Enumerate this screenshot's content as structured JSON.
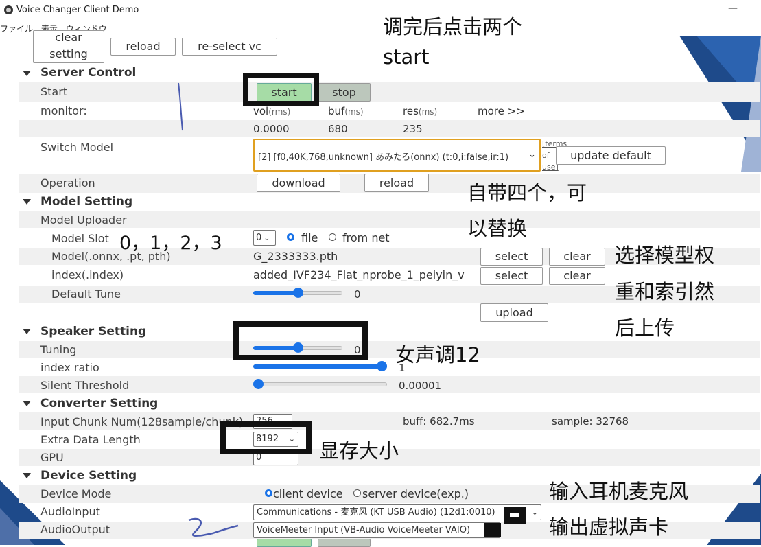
{
  "window": {
    "title": "Voice Changer Client Demo",
    "minimize": "—",
    "maximize": "☐",
    "close": "✕"
  },
  "menu": [
    "ファイル",
    "表示",
    "ウィンドウ"
  ],
  "top_buttons": {
    "clear_line1": "clear",
    "clear_line2": "setting",
    "reload": "reload",
    "reselect": "re-select vc"
  },
  "server_control": {
    "title": "Server Control",
    "start_label": "Start",
    "start_btn": "start",
    "stop_btn": "stop",
    "monitor_label": "monitor:",
    "vol": "vol",
    "vol_unit": "(rms)",
    "buf": "buf",
    "buf_unit": "(ms)",
    "res": "res",
    "res_unit": "(ms)",
    "more": "more >>",
    "vol_value": "0.0000",
    "buf_value": "680",
    "res_value": "235",
    "switch_model_label": "Switch Model",
    "model_selected": "[2] [f0,40K,768,unknown] あみたろ(onnx) (t:0,i:false,ir:1)",
    "terms": "[terms",
    "of": "of",
    "use": "use]",
    "update_default": "update default",
    "operation_label": "Operation",
    "download": "download",
    "reload": "reload"
  },
  "model_setting": {
    "title": "Model Setting",
    "uploader_label": "Model Uploader",
    "slot_label": "Model Slot",
    "slot_value": "0",
    "file_option": "file",
    "net_option": "from net",
    "model_label": "Model(.onnx, .pt, pth)",
    "model_file": "G_2333333.pth",
    "index_label": "index(.index)",
    "index_file": "added_IVF234_Flat_nprobe_1_peiyin_v",
    "select": "select",
    "clear": "clear",
    "tune_label": "Default Tune",
    "tune_value": "0",
    "tune_level": 0.5,
    "upload": "upload"
  },
  "speaker_setting": {
    "title": "Speaker Setting",
    "tuning_label": "Tuning",
    "tuning_value": "0",
    "tuning_level": 0.5,
    "index_ratio_label": "index ratio",
    "index_ratio_value": "1",
    "index_ratio_level": 1.0,
    "silent_label": "Silent Threshold",
    "silent_value": "0.00001",
    "silent_level": 0.0
  },
  "converter_setting": {
    "title": "Converter Setting",
    "chunk_label": "Input Chunk Num(128sample/chunk)",
    "chunk_value": "256",
    "buff": "buff: 682.7ms",
    "sample": "sample: 32768",
    "extra_label": "Extra Data Length",
    "extra_value": "8192",
    "gpu_label": "GPU",
    "gpu_value": "0"
  },
  "device_setting": {
    "title": "Device Setting",
    "mode_label": "Device Mode",
    "client_device": "client device",
    "server_device": "server device(exp.)",
    "input_label": "AudioInput",
    "input_value": "Communications - 麦克风 (KT USB Audio) (12d1:0010)",
    "output_label": "AudioOutput",
    "output_value": "VoiceMeeter Input (VB-Audio VoiceMeeter VAIO)"
  },
  "annotations": {
    "a1_line1": "调完后点击两个",
    "a1_line2": "start",
    "a2_line1": "自带四个，可",
    "a2_line2": "以替换",
    "a3": "0，1，2，3",
    "a4_line1": "选择模型权",
    "a4_line2": "重和索引然",
    "a4_line3": "后上传",
    "a5": "女声调12",
    "a6": "显存大小",
    "a7_line1": "输入耳机麦克风",
    "a7_line2": "输出虚拟声卡"
  },
  "colors": {
    "accent": "#1a73e8",
    "start_green": "#a6dca6",
    "deco_blue": "#1e4a8a",
    "row_shade": "#f0f0f0"
  }
}
